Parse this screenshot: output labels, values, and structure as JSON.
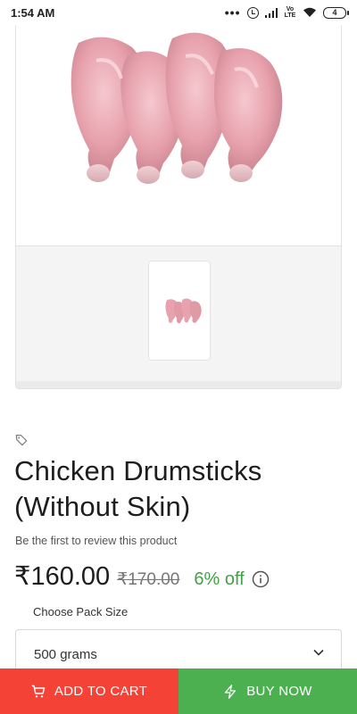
{
  "status_bar": {
    "time": "1:54 AM",
    "dots": "•••",
    "network_label": "Vo LTE",
    "battery": "4"
  },
  "product": {
    "title": "Chicken Drumsticks (Without Skin)",
    "review_prompt": "Be the first to review this product",
    "price": "₹160.00",
    "old_price": "₹170.00",
    "discount": "6% off"
  },
  "pack": {
    "label": "Choose Pack Size",
    "selected": "500 grams"
  },
  "actions": {
    "add_to_cart": "ADD TO CART",
    "buy_now": "BUY NOW"
  },
  "colors": {
    "cart": "#f44336",
    "buy": "#4caf50",
    "discount": "#43a047"
  }
}
